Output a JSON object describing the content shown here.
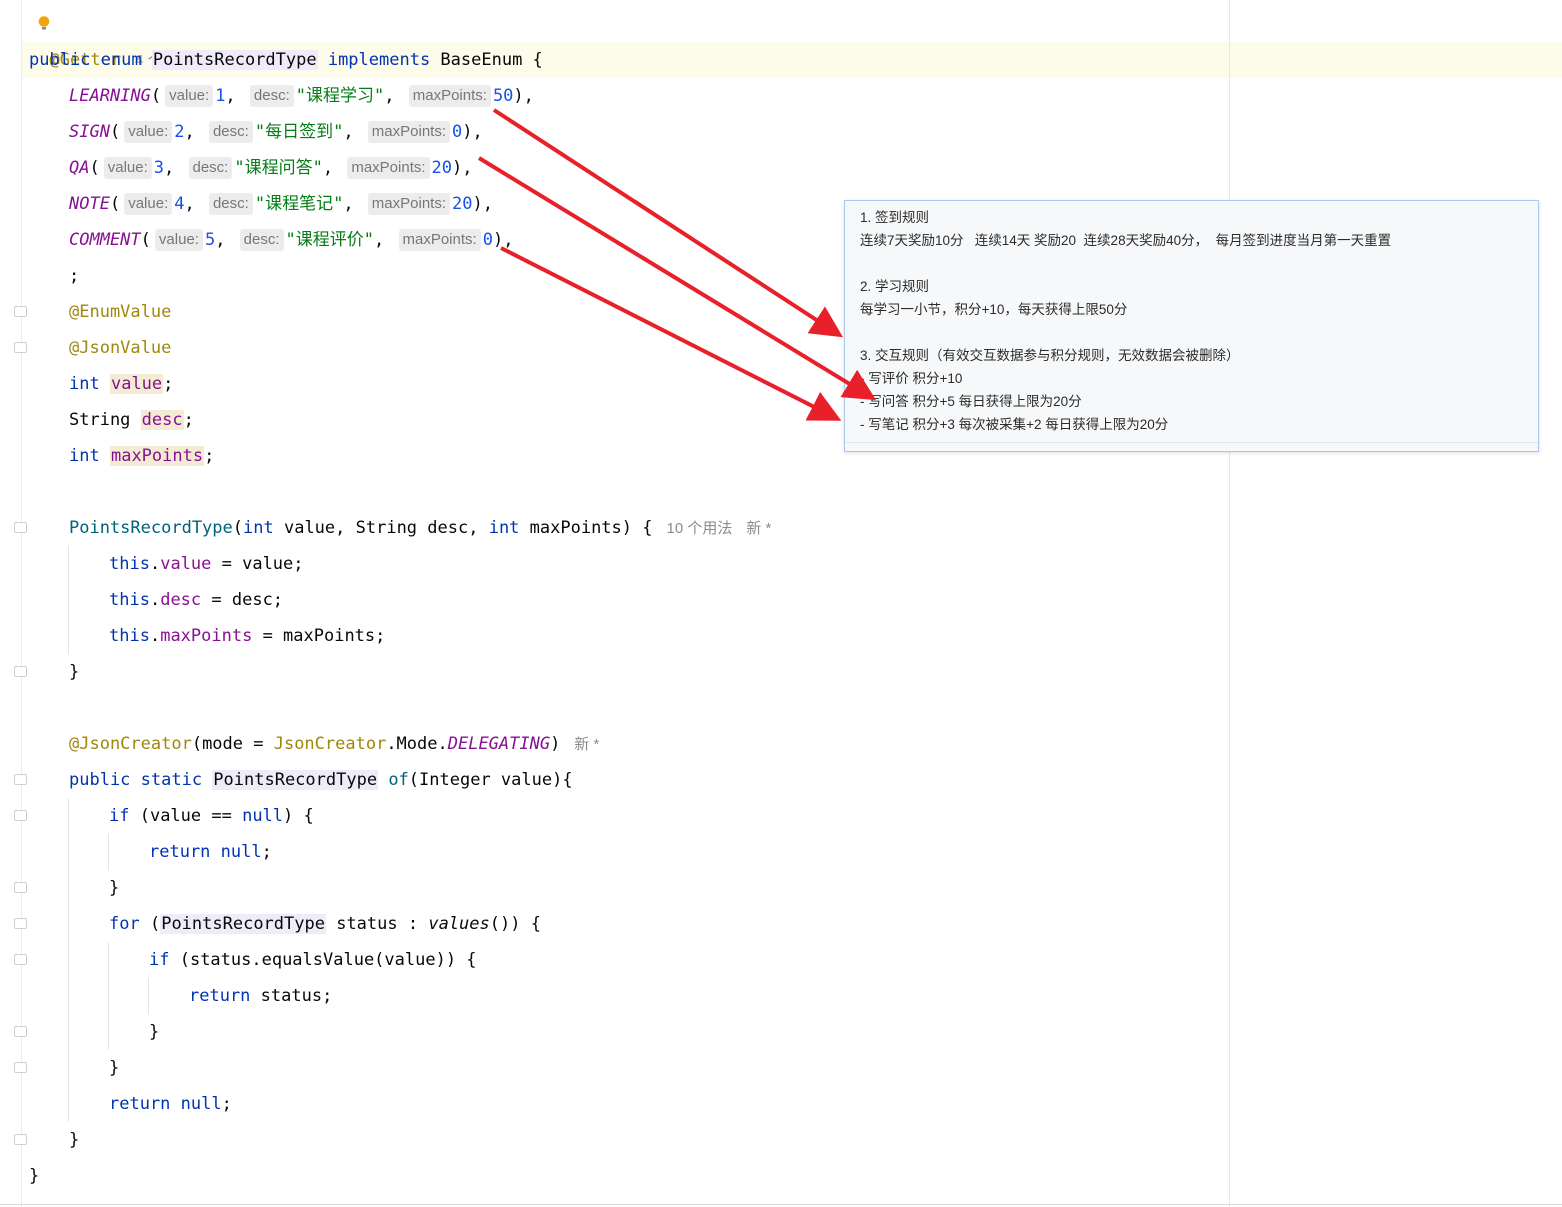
{
  "editor": {
    "l1": {
      "annotation": "@Getter",
      "usages": "4 个用法",
      "status": "新 *"
    },
    "l2": {
      "kw": "public enum ",
      "name": "PointsRecordType",
      "impl": " implements ",
      "base": "BaseEnum {"
    },
    "enum_consts": [
      {
        "name": "LEARNING",
        "value": "1",
        "desc": "\"课程学习\"",
        "maxPoints": "50",
        "end": "),"
      },
      {
        "name": "SIGN",
        "value": "2",
        "desc": "\"每日签到\"",
        "maxPoints": "0",
        "end": "),"
      },
      {
        "name": "QA",
        "value": "3",
        "desc": "\"课程问答\"",
        "maxPoints": "20",
        "end": "),"
      },
      {
        "name": "NOTE",
        "value": "4",
        "desc": "\"课程笔记\"",
        "maxPoints": "20",
        "end": "),"
      },
      {
        "name": "COMMENT",
        "value": "5",
        "desc": "\"课程评价\"",
        "maxPoints": "0",
        "end": "),"
      }
    ],
    "hints": {
      "value": "value:",
      "desc": "desc:",
      "maxPoints": "maxPoints:"
    },
    "semicolon": ";",
    "ann_enum_value": "@EnumValue",
    "ann_json_value": "@JsonValue",
    "fields": [
      {
        "type": "int",
        "name": "value"
      },
      {
        "type": "String",
        "name": "desc"
      },
      {
        "type": "int",
        "name": "maxPoints"
      }
    ],
    "ctor": {
      "name": "PointsRecordType",
      "t1": "int",
      "p1": " value, ",
      "t2": "String",
      "p2": " desc, ",
      "t3": "int",
      "p3": " maxPoints) {",
      "usages": "10 个用法",
      "status": "新 *"
    },
    "ctor_body": [
      {
        "this": "this",
        "field": "value",
        "rest": " = value;"
      },
      {
        "this": "this",
        "field": "desc",
        "rest": " = desc;"
      },
      {
        "this": "this",
        "field": "maxPoints",
        "rest": " = maxPoints;"
      }
    ],
    "close_brace": "}",
    "json_creator": {
      "ann": "@JsonCreator",
      "p1": "(mode = ",
      "cls": "JsonCreator",
      "p2": ".Mode.",
      "mode": "DELEGATING",
      "p3": ")",
      "status": "新 *"
    },
    "of_decl": {
      "kw": "public static ",
      "type": "PointsRecordType",
      "meth": "of",
      "rest": "(Integer value){"
    },
    "if1": {
      "kw": "if",
      "mid": " (value == ",
      "nl": "null",
      "rest": ") {"
    },
    "ret_null": {
      "kw": "return",
      "sp": " ",
      "nl": "null",
      "rest": ";"
    },
    "for_loop": {
      "kw": "for",
      "p1": " (",
      "type": "PointsRecordType",
      "p2": " status : ",
      "call": "values",
      "p3": "()) {"
    },
    "if2": {
      "kw": "if",
      "rest": " (status.equalsValue(value)) {"
    },
    "ret_status": {
      "kw": "return",
      "rest": " status;"
    },
    "ret_null2": {
      "kw": "return",
      "sp": " ",
      "nl": "null",
      "rest": ";"
    }
  },
  "popup": {
    "lines": [
      "1. 签到规则",
      "连续7天奖励10分   连续14天 奖励20  连续28天奖励40分，  每月签到进度当月第一天重置",
      "",
      "2. 学习规则",
      "每学习一小节，积分+10，每天获得上限50分",
      "",
      "3. 交互规则（有效交互数据参与积分规则，无效数据会被删除）",
      "- 写评价 积分+10",
      "- 写问答 积分+5 每日获得上限为20分",
      "- 写笔记 积分+3 每次被采集+2 每日获得上限为20分"
    ]
  },
  "colors": {
    "arrow": "#e8202a",
    "keyword": "#0033b3",
    "enum_constant": "#871094",
    "string": "#067d17",
    "number": "#1750eb",
    "annotation": "#9e880d"
  }
}
